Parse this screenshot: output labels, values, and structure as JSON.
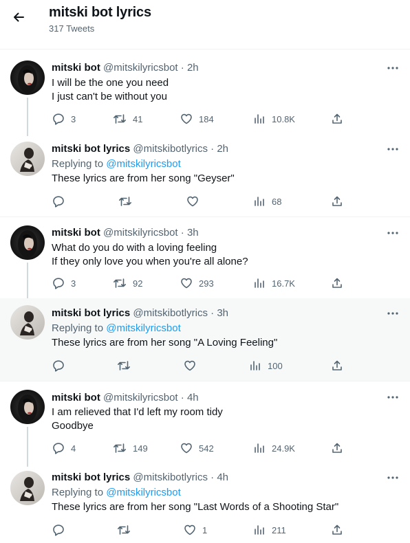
{
  "header": {
    "title": "mitski bot lyrics",
    "tweet_count": "317 Tweets"
  },
  "tweets": [
    {
      "name": "mitski bot",
      "handle": "@mitskilyricsbot",
      "dot": "·",
      "time": "2h",
      "lines": [
        "I will be the one you need",
        "I just can't be without you"
      ],
      "replies": "3",
      "retweets": "41",
      "likes": "184",
      "views": "10.8K"
    },
    {
      "name": "mitski bot lyrics",
      "handle": "@mitskibotlyrics",
      "dot": "·",
      "time": "2h",
      "replying_label": "Replying to",
      "replying_to": "@mitskilyricsbot",
      "lines": [
        "These lyrics are from her song \"Geyser\""
      ],
      "views": "68"
    },
    {
      "name": "mitski bot",
      "handle": "@mitskilyricsbot",
      "dot": "·",
      "time": "3h",
      "lines": [
        "What do you do with a loving feeling",
        "If they only love you when you're all alone?"
      ],
      "replies": "3",
      "retweets": "92",
      "likes": "293",
      "views": "16.7K"
    },
    {
      "name": "mitski bot lyrics",
      "handle": "@mitskibotlyrics",
      "dot": "·",
      "time": "3h",
      "replying_label": "Replying to",
      "replying_to": "@mitskilyricsbot",
      "lines": [
        "These lyrics are from her song \"A Loving Feeling\""
      ],
      "views": "100"
    },
    {
      "name": "mitski bot",
      "handle": "@mitskilyricsbot",
      "dot": "·",
      "time": "4h",
      "lines": [
        "I am relieved that I'd left my room tidy",
        "Goodbye"
      ],
      "replies": "4",
      "retweets": "149",
      "likes": "542",
      "views": "24.9K"
    },
    {
      "name": "mitski bot lyrics",
      "handle": "@mitskibotlyrics",
      "dot": "·",
      "time": "4h",
      "replying_label": "Replying to",
      "replying_to": "@mitskilyricsbot",
      "lines": [
        "These lyrics are from her song \"Last Words of a Shooting Star\""
      ],
      "likes": "1",
      "views": "211"
    }
  ],
  "icons": {
    "back": "arrow-left-icon",
    "more": "more-dots-icon",
    "reply": "reply-bubble-icon",
    "retweet": "retweet-icon",
    "like": "heart-icon",
    "views": "views-bar-chart-icon",
    "share": "share-icon"
  },
  "colors": {
    "link": "#1d9bf0",
    "muted": "#536471",
    "text": "#0f1419",
    "thread_line": "#cfd9de",
    "highlight_bg": "#f7f9f9"
  }
}
